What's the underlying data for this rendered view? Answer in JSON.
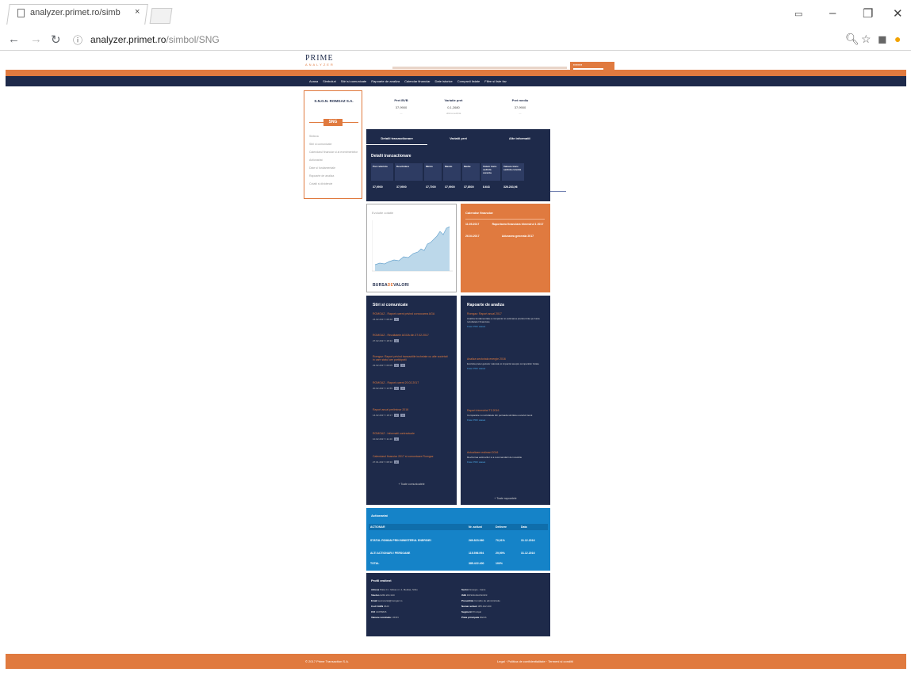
{
  "browser": {
    "tab_title": "analyzer.primet.ro/simb",
    "tab_close": "×",
    "url_host": "analyzer.primet.ro",
    "url_path": "/simbol/SNG",
    "min": "–",
    "max": "❐",
    "close": "✕"
  },
  "site": {
    "logo": "PRIME",
    "logo_sub": "ANALYZER",
    "nav": [
      "Acasa",
      "Simboluri",
      "Stiri si comunicate",
      "Rapoarte de analiza",
      "Calendar financiar",
      "Date istorice",
      "Companii listate",
      "Filtre si liste fav"
    ]
  },
  "company": {
    "name": "S.N.G.N. ROMGAZ S.A.",
    "symbol": "SNG",
    "menu": [
      "Sinteza",
      "Stiri si comunicate",
      "Calendarul financiar si al evenimentelor",
      "Actionariat",
      "Date si fundamentale",
      "Rapoarte de analiza",
      "Cotatii si dividende"
    ]
  },
  "stats": [
    {
      "label": "Pret BVB",
      "value": "37,9900",
      "sub": "—"
    },
    {
      "label": "Variatie pret",
      "value": "0,1,2680",
      "sub": "ultima sedinta"
    },
    {
      "label": "Pret mediu",
      "value": "37,9900",
      "sub": "—"
    }
  ],
  "trading": {
    "tabs": [
      "Detalii tranzactionare",
      "Variatii pret",
      "Alte informatii"
    ],
    "title": "Detalii tranzactionare",
    "headers": [
      "Pret referinta",
      "Deschidere",
      "Minim",
      "Maxim",
      "Medie",
      "Volum tranz. sedinta curenta",
      "Valoare tranz. sedinta curenta"
    ],
    "values": [
      "37,9900",
      "37,9900",
      "37,7000",
      "37,9900",
      "37,8500",
      "8.643",
      "326.283,96"
    ]
  },
  "chart": {
    "title": "Evolutie cotatie",
    "bvb_a": "BURSA",
    "bvb_b": "DE",
    "bvb_c": "VALORI"
  },
  "calendar": {
    "title": "Calendar financiar",
    "rows": [
      {
        "date": "11.05.2017",
        "event": "Raportarea financiara trimestrul 1 2017"
      },
      {
        "date": "26.04.2017",
        "event": "Adunarea generala 2017"
      }
    ]
  },
  "news": {
    "title": "Stiri si comunicate",
    "items": [
      {
        "link": "ROMGAZ - Raport curent privind convocarea AGA",
        "meta": "24.02.2017 / 08:48"
      },
      {
        "link": "ROMGAZ - Rezultatele AGOA din 27.02.2017",
        "meta": "27.02.2017 / 18:32"
      },
      {
        "link": "Romgaz: Raport privind tranzactiile incheiate cu alte societati in care statul are participatii",
        "meta": "22.02.2017 / 09:05"
      },
      {
        "link": "ROMGAZ - Raport curent 20.02.2017",
        "meta": "20.02.2017 / 13:55"
      },
      {
        "link": "Raport anual preliminar 2016",
        "meta": "14.02.2017 / 18:17"
      },
      {
        "link": "ROMGAZ - Informatii contractuale",
        "meta": "10.02.2017 / 11:20"
      },
      {
        "link": "Calendarul financiar 2017 si comunicare Romgaz",
        "meta": "27.01.2017 / 08:30"
      }
    ],
    "more": "+ Toate comunicatele"
  },
  "reports": {
    "title": "Rapoarte de analiza",
    "items": [
      {
        "title": "Romgaz: Raport anual 2017",
        "text": "Analiza fundamentala a companiei si estimarea pretului tinta pe baza rezultatelor financiare",
        "attach": "Fisier PDF atasat"
      },
      {
        "title": "Analiza sectoriala energie 2016",
        "text": "Evolutia pietei gazelor naturale si impactul asupra companiilor listate",
        "attach": "Fisier PDF atasat"
      },
      {
        "title": "Raport trimestrial T3 2016",
        "text": "Comparatie cu rezultatele din perioada similara a anului trecut",
        "attach": "Fisier PDF atasat"
      },
      {
        "title": "Actualizare estimari 2016",
        "text": "Revizuirea estimarilor si a recomandarii de investitie",
        "attach": "Fisier PDF atasat"
      }
    ],
    "more": "+ Toate rapoartele"
  },
  "shareholders": {
    "title": "Actionariat",
    "headers": [
      "ACTIONAR",
      "Nr. actiuni",
      "Detinere",
      "Data"
    ],
    "rows": [
      [
        "STATUL ROMAN PRIN MINISTERUL ENERGIEI",
        "269.823.060",
        "70,01%",
        "31.12.2016"
      ],
      [
        "ALTI ACTIONARI / PERSOANE",
        "115.596.994",
        "29,99%",
        "31.12.2016"
      ],
      [
        "TOTAL",
        "385.422.400",
        "100%",
        ""
      ]
    ]
  },
  "profile": {
    "title": "Profil emitent",
    "left": [
      [
        "Adresa",
        "Piata C.I. Motas nr. 4, Medias, Sibiu"
      ],
      [
        "Telefon",
        "0269 201 020"
      ],
      [
        "Email",
        "secretariat@romgaz.ro"
      ],
      [
        "Cod CAEN",
        "0620"
      ],
      [
        "CUI",
        "14056826"
      ],
      [
        "Valoare nominala",
        "1 RON"
      ]
    ],
    "right": [
      [
        "Sector",
        "Energie - Gaze"
      ],
      [
        "ISIN",
        "ROSNGNACNOR3"
      ],
      [
        "Presedinte",
        "Consiliu de administratie"
      ],
      [
        "Numar actiuni",
        "385.422.400"
      ],
      [
        "Segment",
        "Principal"
      ],
      [
        "Piata principala",
        "REGS"
      ]
    ]
  },
  "footer": {
    "left": "© 2017 Prime Transaction S.A.",
    "right": "Legal  ·  Politica de confidentialitate  ·  Termeni si conditii"
  }
}
